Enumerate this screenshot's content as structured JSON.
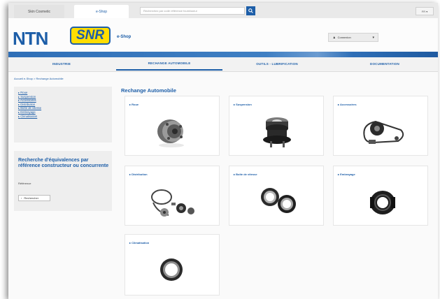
{
  "topbar": {
    "tabs": [
      "Skin Cosmetic",
      "e-Shop"
    ],
    "search_placeholder": "Recherchez par code référence fournisseur",
    "lang": "FR ▾"
  },
  "logo": {
    "ntn": "NTN",
    "snr": "SNR",
    "eshop": "e-Shop"
  },
  "account": {
    "label": "Connexion"
  },
  "nav": [
    "INDUSTRIE",
    "RECHANGE AUTOMOBILE",
    "OUTILS - LUBRIFICATION",
    "DOCUMENTATION"
  ],
  "breadcrumb": "Accueil e-Shop > Rechange Automobile",
  "sidebar": {
    "items": [
      "Roue",
      "Suspension",
      "Accessoires",
      "Distribution",
      "Boîte de vitesse",
      "Embrayage",
      "Climatisation"
    ],
    "equiv_title": "Recherche d'équivalences par référence constructeur ou concurrente",
    "ref_label": "Référence",
    "search_button": "Rechercher"
  },
  "main": {
    "title": "Rechange Automobile",
    "cards": [
      "Roue",
      "Suspension",
      "Accessoires",
      "Distribution",
      "Boîte de vitesse",
      "Embrayage",
      "Climatisation"
    ]
  },
  "colors": {
    "brand_blue": "#1d5ea8",
    "snr_yellow": "#ffdd00"
  }
}
